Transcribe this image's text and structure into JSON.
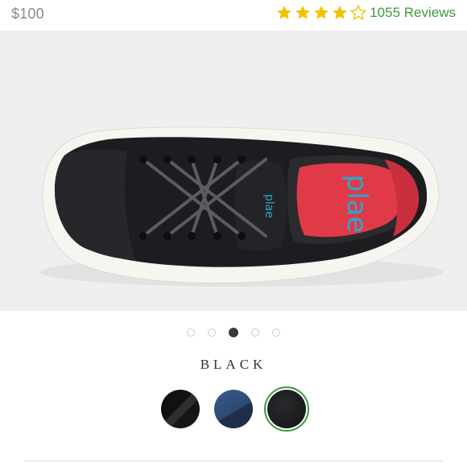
{
  "product": {
    "price": "$100"
  },
  "rating": {
    "value": 4,
    "max": 5,
    "reviews_label": "1055 Reviews",
    "star_color": "#f2c300"
  },
  "gallery": {
    "image_count": 5,
    "active_index": 2,
    "insole_logo": "plae"
  },
  "color": {
    "selected_label": "BLACK",
    "swatches": [
      {
        "name": "black-textured",
        "color": "#1a1a1a"
      },
      {
        "name": "navy-blue",
        "color": "#2c4a72"
      },
      {
        "name": "black",
        "color": "#1c1c1e",
        "selected": true
      }
    ]
  },
  "accent_colors": {
    "reviews_text": "#3a9a3a",
    "selected_ring": "#3a9a3a",
    "insole": "#e03a48",
    "logo": "#2aa8d0"
  }
}
